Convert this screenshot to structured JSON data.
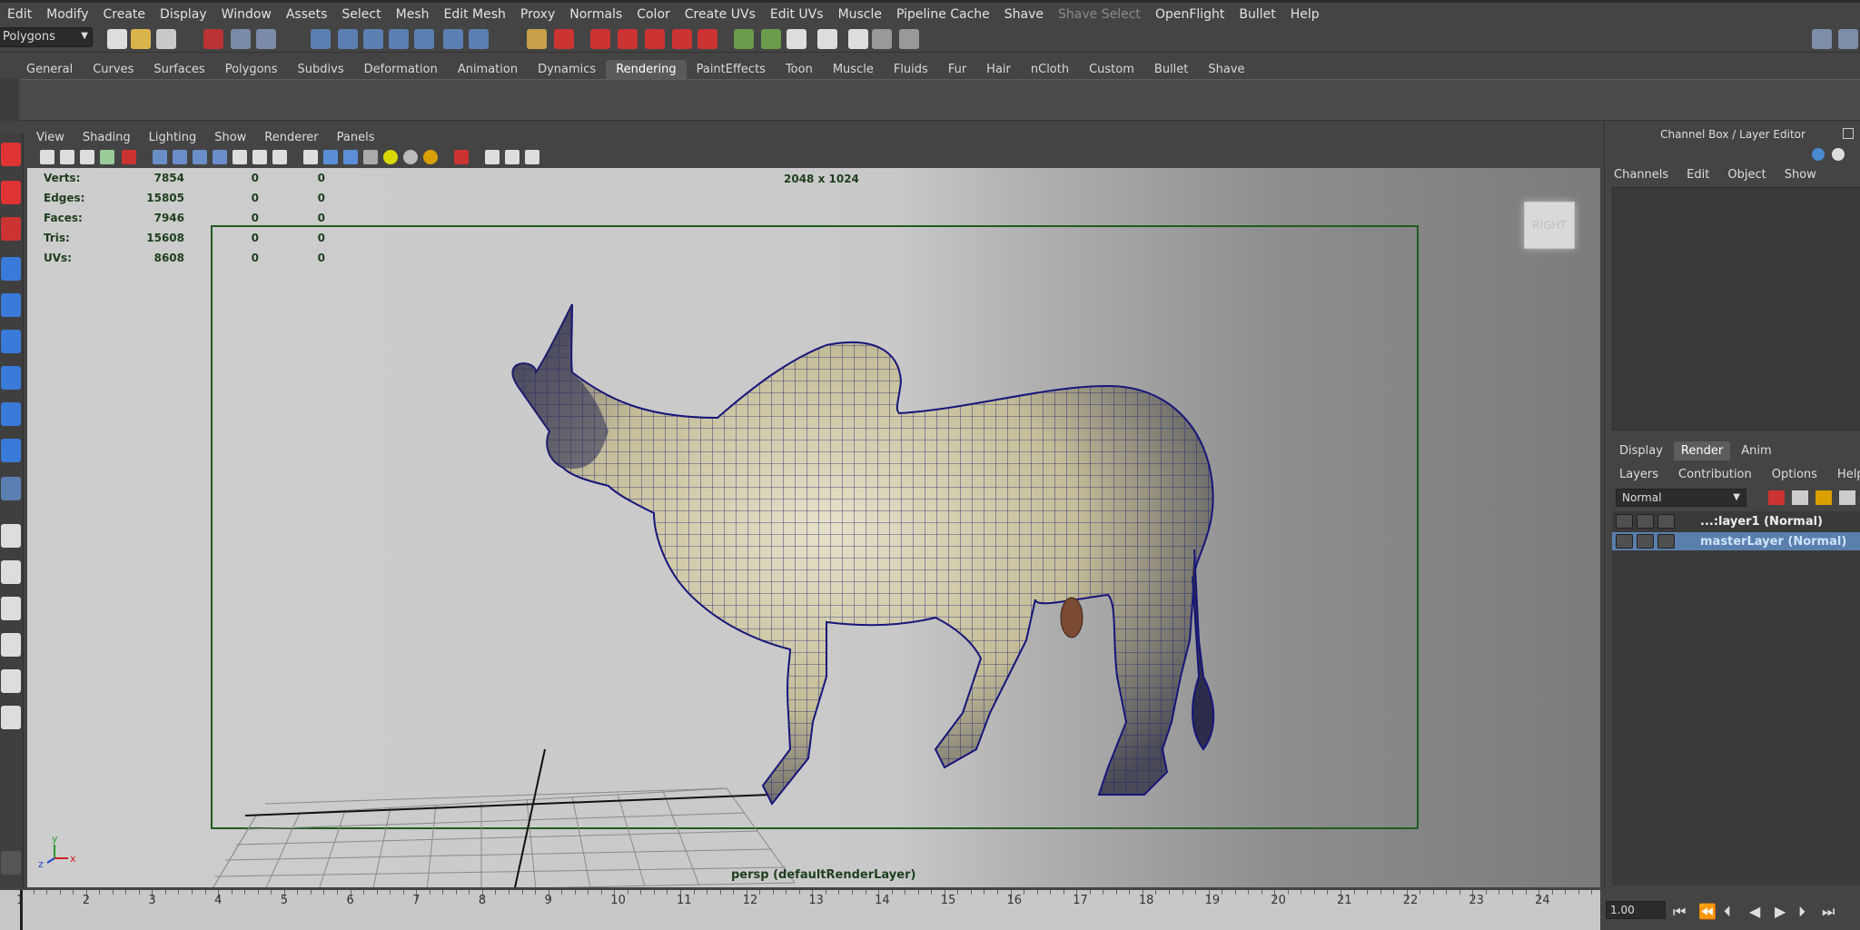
{
  "menubar": {
    "items": [
      "Edit",
      "Modify",
      "Create",
      "Display",
      "Window",
      "Assets",
      "Select",
      "Mesh",
      "Edit Mesh",
      "Proxy",
      "Normals",
      "Color",
      "Create UVs",
      "Edit UVs",
      "Muscle",
      "Pipeline Cache",
      "Shave",
      "Shave Select",
      "OpenFlight",
      "Bullet",
      "Help"
    ],
    "disabled_item": "Shave Select"
  },
  "status_line": {
    "mode": "Polygons"
  },
  "shelf": {
    "tabs": [
      "General",
      "Curves",
      "Surfaces",
      "Polygons",
      "Subdivs",
      "Deformation",
      "Animation",
      "Dynamics",
      "Rendering",
      "PaintEffects",
      "Toon",
      "Muscle",
      "Fluids",
      "Fur",
      "Hair",
      "nCloth",
      "Custom",
      "Bullet",
      "Shave"
    ],
    "active_tab": "Rendering"
  },
  "panel": {
    "menu": [
      "View",
      "Shading",
      "Lighting",
      "Show",
      "Renderer",
      "Panels"
    ]
  },
  "viewport": {
    "hud": [
      {
        "label": "Verts:",
        "v1": "7854",
        "v2": "0",
        "v3": "0"
      },
      {
        "label": "Edges:",
        "v1": "15805",
        "v2": "0",
        "v3": "0"
      },
      {
        "label": "Faces:",
        "v1": "7946",
        "v2": "0",
        "v3": "0"
      },
      {
        "label": "Tris:",
        "v1": "15608",
        "v2": "0",
        "v3": "0"
      },
      {
        "label": "UVs:",
        "v1": "8608",
        "v2": "0",
        "v3": "0"
      }
    ],
    "resolution_label": "2048 x 1024",
    "camera_label": "persp (defaultRenderLayer)",
    "viewcube_label": "RIGHT",
    "axis_labels": {
      "y": "y",
      "z": "z",
      "x": "x"
    }
  },
  "channel_box": {
    "title": "Channel Box / Layer Editor",
    "menu": [
      "Channels",
      "Edit",
      "Object",
      "Show"
    ]
  },
  "layer_editor": {
    "tabs": [
      "Display",
      "Render",
      "Anim"
    ],
    "active_tab": "Render",
    "menu": [
      "Layers",
      "Contribution",
      "Options",
      "Help"
    ],
    "blend_mode": "Normal",
    "layers": [
      {
        "name": "...:layer1 (Normal)",
        "selected": false
      },
      {
        "name": "masterLayer (Normal)",
        "selected": true
      }
    ]
  },
  "time_slider": {
    "ticks": [
      "1",
      "2",
      "3",
      "4",
      "5",
      "6",
      "7",
      "8",
      "9",
      "10",
      "11",
      "12",
      "13",
      "14",
      "15",
      "16",
      "17",
      "18",
      "19",
      "20",
      "21",
      "22",
      "23",
      "24"
    ],
    "current_time": "1.00"
  },
  "colors": {
    "ui_bg": "#444444",
    "selection_blue": "#5a7fad",
    "wire": "#16167a",
    "hud_text": "#1e3e1e"
  }
}
